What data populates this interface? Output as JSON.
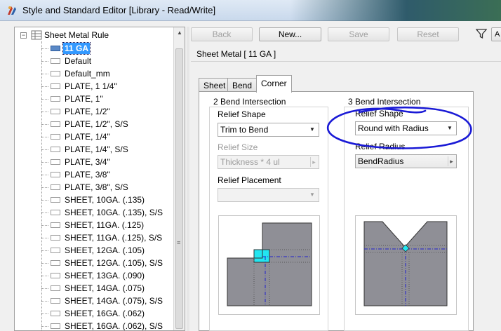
{
  "window": {
    "title": "Style and Standard Editor [Library - Read/Write]"
  },
  "tree": {
    "root_label": "Sheet Metal Rule",
    "items": [
      "11 GA",
      "Default",
      "Default_mm",
      "PLATE, 1 1/4\"",
      "PLATE, 1\"",
      "PLATE, 1/2\"",
      "PLATE, 1/2\", S/S",
      "PLATE, 1/4\"",
      "PLATE, 1/4\", S/S",
      "PLATE, 3/4\"",
      "PLATE, 3/8\"",
      "PLATE, 3/8\", S/S",
      "SHEET, 10GA. (.135)",
      "SHEET, 10GA. (.135), S/S",
      "SHEET, 11GA. (.125)",
      "SHEET, 11GA. (.125), S/S",
      "SHEET, 12GA. (.105)",
      "SHEET, 12GA. (.105), S/S",
      "SHEET, 13GA. (.090)",
      "SHEET, 14GA. (.075)",
      "SHEET, 14GA. (.075), S/S",
      "SHEET, 16GA. (.062)",
      "SHEET, 16GA. (.062), S/S"
    ],
    "selected_index": 0
  },
  "toolbar": {
    "back_label": "Back",
    "new_label": "New...",
    "save_label": "Save",
    "reset_label": "Reset",
    "right_stub_label": "A"
  },
  "panel": {
    "section_title": "Sheet Metal [ 11 GA ]",
    "tabs": [
      "Sheet",
      "Bend",
      "Corner"
    ],
    "active_tab": "Corner"
  },
  "two_bend": {
    "group_label": "2 Bend Intersection",
    "relief_shape_label": "Relief Shape",
    "relief_shape_value": "Trim to Bend",
    "relief_size_label": "Relief Size",
    "relief_size_value": "Thickness * 4 ul",
    "relief_placement_label": "Relief Placement",
    "relief_placement_value": ""
  },
  "three_bend": {
    "group_label": "3 Bend Intersection",
    "relief_shape_label": "Relief Shape",
    "relief_shape_value": "Round with Radius",
    "relief_radius_label": "Relief Radius",
    "relief_radius_value": "BendRadius"
  },
  "colors": {
    "selection": "#3399ff",
    "annotation": "#1a1ad6",
    "preview_fill": "#8f8f96",
    "relief_highlight": "#22e6f0",
    "centerline": "#2222cc"
  }
}
